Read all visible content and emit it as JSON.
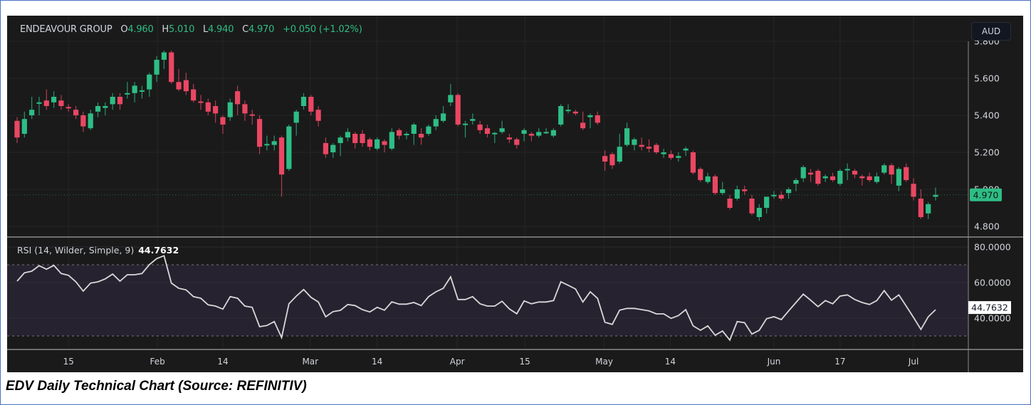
{
  "header": {
    "symbol": "ENDEAVOUR GROUP",
    "o_label": "O",
    "o_value": "4.960",
    "h_label": "H",
    "h_value": "5.010",
    "l_label": "L",
    "l_value": "4.940",
    "c_label": "C",
    "c_value": "4.970",
    "change": "+0.050 (+1.02%)"
  },
  "currency_button": "AUD",
  "last_price_label": "4.970",
  "rsi_header": {
    "label": "RSI (14, Wilder, Simple, 9)",
    "value": "44.7632"
  },
  "rsi_last_label": "44.7632",
  "caption": "EDV Daily Technical Chart (Source: REFINITIV)",
  "colors": {
    "up": "#2ebd85",
    "down": "#ea4763",
    "background": "#1a1a1a",
    "rsi_line": "#d8d8d8",
    "rsi_band": "#272230"
  },
  "chart_data": {
    "type": "candlestick",
    "title": "ENDEAVOUR GROUP",
    "ylabel": "AUD",
    "ylim": [
      4.75,
      5.82
    ],
    "y_ticks": [
      "5.800",
      "5.600",
      "5.400",
      "5.200",
      "5.000",
      "4.800"
    ],
    "x_ticks": [
      {
        "label": "15",
        "index": 7
      },
      {
        "label": "Feb",
        "index": 19.1
      },
      {
        "label": "14",
        "index": 28
      },
      {
        "label": "Mar",
        "index": 39.9
      },
      {
        "label": "14",
        "index": 49
      },
      {
        "label": "Apr",
        "index": 59.9
      },
      {
        "label": "15",
        "index": 69.1
      },
      {
        "label": "May",
        "index": 79.9
      },
      {
        "label": "14",
        "index": 88.9
      },
      {
        "label": "Jun",
        "index": 103
      },
      {
        "label": "17",
        "index": 112
      },
      {
        "label": "Jul",
        "index": 122
      }
    ],
    "candles_ohlc": [
      [
        5.37,
        5.39,
        5.25,
        5.28
      ],
      [
        5.3,
        5.42,
        5.28,
        5.38
      ],
      [
        5.4,
        5.5,
        5.38,
        5.43
      ],
      [
        5.47,
        5.5,
        5.4,
        5.47
      ],
      [
        5.48,
        5.54,
        5.43,
        5.45
      ],
      [
        5.47,
        5.53,
        5.44,
        5.5
      ],
      [
        5.48,
        5.51,
        5.43,
        5.45
      ],
      [
        5.445,
        5.46,
        5.42,
        5.44
      ],
      [
        5.43,
        5.45,
        5.38,
        5.4
      ],
      [
        5.4,
        5.42,
        5.31,
        5.34
      ],
      [
        5.33,
        5.43,
        5.32,
        5.41
      ],
      [
        5.42,
        5.47,
        5.39,
        5.45
      ],
      [
        5.44,
        5.47,
        5.4,
        5.45
      ],
      [
        5.46,
        5.52,
        5.43,
        5.5
      ],
      [
        5.5,
        5.52,
        5.43,
        5.46
      ],
      [
        5.515,
        5.58,
        5.49,
        5.52
      ],
      [
        5.52,
        5.58,
        5.47,
        5.56
      ],
      [
        5.53,
        5.56,
        5.49,
        5.535
      ],
      [
        5.54,
        5.63,
        5.5,
        5.62
      ],
      [
        5.62,
        5.72,
        5.58,
        5.7
      ],
      [
        5.7,
        5.75,
        5.65,
        5.74
      ],
      [
        5.74,
        5.75,
        5.57,
        5.58
      ],
      [
        5.58,
        5.65,
        5.53,
        5.54
      ],
      [
        5.59,
        5.63,
        5.51,
        5.53
      ],
      [
        5.54,
        5.57,
        5.47,
        5.48
      ],
      [
        5.475,
        5.51,
        5.43,
        5.47
      ],
      [
        5.47,
        5.49,
        5.4,
        5.42
      ],
      [
        5.45,
        5.48,
        5.36,
        5.41
      ],
      [
        5.39,
        5.4,
        5.3,
        5.35
      ],
      [
        5.39,
        5.49,
        5.37,
        5.47
      ],
      [
        5.53,
        5.56,
        5.4,
        5.46
      ],
      [
        5.46,
        5.48,
        5.37,
        5.41
      ],
      [
        5.405,
        5.43,
        5.35,
        5.4
      ],
      [
        5.38,
        5.4,
        5.19,
        5.23
      ],
      [
        5.24,
        5.29,
        5.21,
        5.245
      ],
      [
        5.24,
        5.29,
        5.21,
        5.26
      ],
      [
        5.28,
        5.29,
        4.96,
        5.08
      ],
      [
        5.11,
        5.35,
        5.1,
        5.34
      ],
      [
        5.36,
        5.43,
        5.29,
        5.42
      ],
      [
        5.45,
        5.52,
        5.43,
        5.5
      ],
      [
        5.5,
        5.51,
        5.4,
        5.42
      ],
      [
        5.43,
        5.45,
        5.34,
        5.37
      ],
      [
        5.25,
        5.28,
        5.17,
        5.19
      ],
      [
        5.2,
        5.25,
        5.17,
        5.24
      ],
      [
        5.25,
        5.29,
        5.18,
        5.28
      ],
      [
        5.28,
        5.33,
        5.26,
        5.31
      ],
      [
        5.3,
        5.31,
        5.22,
        5.25
      ],
      [
        5.3,
        5.32,
        5.23,
        5.25
      ],
      [
        5.27,
        5.28,
        5.21,
        5.23
      ],
      [
        5.22,
        5.28,
        5.21,
        5.27
      ],
      [
        5.26,
        5.27,
        5.2,
        5.24
      ],
      [
        5.22,
        5.33,
        5.21,
        5.31
      ],
      [
        5.32,
        5.33,
        5.27,
        5.29
      ],
      [
        5.295,
        5.31,
        5.27,
        5.3
      ],
      [
        5.3,
        5.36,
        5.24,
        5.35
      ],
      [
        5.3,
        5.33,
        5.24,
        5.28
      ],
      [
        5.3,
        5.35,
        5.29,
        5.34
      ],
      [
        5.34,
        5.4,
        5.32,
        5.38
      ],
      [
        5.37,
        5.45,
        5.36,
        5.41
      ],
      [
        5.47,
        5.57,
        5.45,
        5.51
      ],
      [
        5.51,
        5.52,
        5.34,
        5.35
      ],
      [
        5.35,
        5.37,
        5.28,
        5.355
      ],
      [
        5.37,
        5.41,
        5.35,
        5.38
      ],
      [
        5.35,
        5.37,
        5.3,
        5.32
      ],
      [
        5.33,
        5.35,
        5.28,
        5.3
      ],
      [
        5.3,
        5.31,
        5.25,
        5.305
      ],
      [
        5.31,
        5.37,
        5.3,
        5.33
      ],
      [
        5.28,
        5.3,
        5.25,
        5.27
      ],
      [
        5.27,
        5.28,
        5.22,
        5.24
      ],
      [
        5.3,
        5.33,
        5.26,
        5.32
      ],
      [
        5.3,
        5.31,
        5.26,
        5.29
      ],
      [
        5.29,
        5.33,
        5.28,
        5.31
      ],
      [
        5.31,
        5.33,
        5.3,
        5.31
      ],
      [
        5.29,
        5.33,
        5.28,
        5.32
      ],
      [
        5.35,
        5.46,
        5.34,
        5.45
      ],
      [
        5.43,
        5.46,
        5.41,
        5.43
      ],
      [
        5.42,
        5.43,
        5.4,
        5.41
      ],
      [
        5.36,
        5.42,
        5.32,
        5.33
      ],
      [
        5.39,
        5.41,
        5.33,
        5.4
      ],
      [
        5.4,
        5.42,
        5.35,
        5.36
      ],
      [
        5.18,
        5.21,
        5.1,
        5.15
      ],
      [
        5.19,
        5.2,
        5.11,
        5.13
      ],
      [
        5.15,
        5.3,
        5.14,
        5.23
      ],
      [
        5.24,
        5.36,
        5.23,
        5.33
      ],
      [
        5.24,
        5.28,
        5.21,
        5.27
      ],
      [
        5.24,
        5.28,
        5.21,
        5.23
      ],
      [
        5.23,
        5.27,
        5.2,
        5.22
      ],
      [
        5.24,
        5.25,
        5.19,
        5.2
      ],
      [
        5.19,
        5.22,
        5.17,
        5.2
      ],
      [
        5.19,
        5.21,
        5.16,
        5.17
      ],
      [
        5.17,
        5.2,
        5.15,
        5.18
      ],
      [
        5.21,
        5.23,
        5.18,
        5.22
      ],
      [
        5.2,
        5.21,
        5.08,
        5.09
      ],
      [
        5.11,
        5.12,
        5.04,
        5.05
      ],
      [
        5.04,
        5.09,
        5.03,
        5.07
      ],
      [
        5.07,
        5.08,
        4.97,
        4.98
      ],
      [
        4.98,
        5.04,
        4.97,
        5.0
      ],
      [
        4.95,
        4.97,
        4.89,
        4.9
      ],
      [
        4.95,
        5.02,
        4.94,
        5.0
      ],
      [
        5.0,
        5.02,
        4.97,
        4.99
      ],
      [
        4.95,
        4.97,
        4.86,
        4.87
      ],
      [
        4.85,
        4.92,
        4.83,
        4.9
      ],
      [
        4.9,
        4.96,
        4.87,
        4.96
      ],
      [
        4.97,
        4.99,
        4.95,
        4.97
      ],
      [
        4.97,
        4.99,
        4.94,
        4.95
      ],
      [
        4.98,
        5.01,
        4.95,
        5.0
      ],
      [
        5.03,
        5.06,
        4.99,
        5.05
      ],
      [
        5.06,
        5.13,
        5.04,
        5.12
      ],
      [
        5.09,
        5.11,
        5.04,
        5.08
      ],
      [
        5.1,
        5.11,
        5.02,
        5.03
      ],
      [
        5.06,
        5.08,
        5.04,
        5.07
      ],
      [
        5.07,
        5.09,
        5.04,
        5.05
      ],
      [
        5.03,
        5.11,
        5.02,
        5.1
      ],
      [
        5.11,
        5.14,
        5.05,
        5.11
      ],
      [
        5.1,
        5.11,
        5.06,
        5.08
      ],
      [
        5.07,
        5.08,
        5.02,
        5.06
      ],
      [
        5.07,
        5.09,
        5.04,
        5.05
      ],
      [
        5.04,
        5.09,
        5.03,
        5.07
      ],
      [
        5.09,
        5.14,
        5.08,
        5.13
      ],
      [
        5.13,
        5.14,
        5.03,
        5.08
      ],
      [
        5.02,
        5.12,
        4.99,
        5.11
      ],
      [
        5.12,
        5.14,
        5.04,
        5.05
      ],
      [
        5.03,
        5.06,
        4.94,
        4.96
      ],
      [
        4.95,
        5.0,
        4.84,
        4.85
      ],
      [
        4.87,
        4.93,
        4.84,
        4.92
      ],
      [
        4.96,
        5.01,
        4.94,
        4.97
      ]
    ],
    "rsi": {
      "name": "RSI (14, Wilder, Simple, 9)",
      "ylim": [
        20,
        82
      ],
      "y_ticks": [
        "80.0000",
        "60.0000",
        "40.0000"
      ],
      "bands": [
        30,
        70
      ],
      "values": [
        60.8,
        65.5,
        66.4,
        69.5,
        67.5,
        69.7,
        65.1,
        64.1,
        60.4,
        55.2,
        59.7,
        60.4,
        62.1,
        64.8,
        60.8,
        64.4,
        64.4,
        65.1,
        70.1,
        73.5,
        75.1,
        59.7,
        56.8,
        55.9,
        52.1,
        51.2,
        47.5,
        46.8,
        45.1,
        52.1,
        51.2,
        46.8,
        46.1,
        35.2,
        35.9,
        38.1,
        29.1,
        48.1,
        52.4,
        56.1,
        51.7,
        49.1,
        40.8,
        43.7,
        44.4,
        47.7,
        47.1,
        44.8,
        43.5,
        46.1,
        44.5,
        49.2,
        47.9,
        47.9,
        48.8,
        47.1,
        52.1,
        54.8,
        56.8,
        63.2,
        50.5,
        50.5,
        52.1,
        48.1,
        46.8,
        46.8,
        49.5,
        45.2,
        42.5,
        49.7,
        48.1,
        49.1,
        49.1,
        49.9,
        60.5,
        58.5,
        56.4,
        49.1,
        54.8,
        51.1,
        37.7,
        36.5,
        44.5,
        45.5,
        45.5,
        44.8,
        44.1,
        42.4,
        42.4,
        39.9,
        41.5,
        44.8,
        35.7,
        33.2,
        35.7,
        30.4,
        32.8,
        27.7,
        38.1,
        37.5,
        31.1,
        33.2,
        39.7,
        40.8,
        39.2,
        44.1,
        48.8,
        53.5,
        50.1,
        46.5,
        49.9,
        48.1,
        52.4,
        53.1,
        50.5,
        48.8,
        47.7,
        49.9,
        55.5,
        50.1,
        53.1,
        46.8,
        40.4,
        33.7,
        40.8,
        44.76
      ]
    }
  }
}
